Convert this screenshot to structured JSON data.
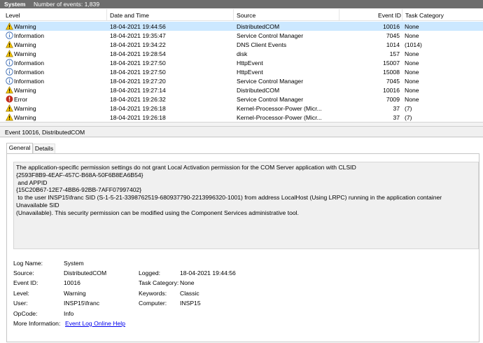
{
  "header": {
    "log_name": "System",
    "event_count": "Number of events: 1,839"
  },
  "columns": [
    "Level",
    "Date and Time",
    "Source",
    "Event ID",
    "Task Category"
  ],
  "rows": [
    {
      "level": "Warning",
      "icon": "warning-icon",
      "date": "18-04-2021 19:44:56",
      "source": "DistributedCOM",
      "event_id": "10016",
      "category": "None",
      "selected": true
    },
    {
      "level": "Information",
      "icon": "information-icon",
      "date": "18-04-2021 19:35:47",
      "source": "Service Control Manager",
      "event_id": "7045",
      "category": "None"
    },
    {
      "level": "Warning",
      "icon": "warning-icon",
      "date": "18-04-2021 19:34:22",
      "source": "DNS Client Events",
      "event_id": "1014",
      "category": "(1014)"
    },
    {
      "level": "Warning",
      "icon": "warning-icon",
      "date": "18-04-2021 19:28:54",
      "source": "disk",
      "event_id": "157",
      "category": "None"
    },
    {
      "level": "Information",
      "icon": "information-icon",
      "date": "18-04-2021 19:27:50",
      "source": "HttpEvent",
      "event_id": "15007",
      "category": "None"
    },
    {
      "level": "Information",
      "icon": "information-icon",
      "date": "18-04-2021 19:27:50",
      "source": "HttpEvent",
      "event_id": "15008",
      "category": "None"
    },
    {
      "level": "Information",
      "icon": "information-icon",
      "date": "18-04-2021 19:27:20",
      "source": "Service Control Manager",
      "event_id": "7045",
      "category": "None"
    },
    {
      "level": "Warning",
      "icon": "warning-icon",
      "date": "18-04-2021 19:27:14",
      "source": "DistributedCOM",
      "event_id": "10016",
      "category": "None"
    },
    {
      "level": "Error",
      "icon": "error-icon",
      "date": "18-04-2021 19:26:32",
      "source": "Service Control Manager",
      "event_id": "7009",
      "category": "None"
    },
    {
      "level": "Warning",
      "icon": "warning-icon",
      "date": "18-04-2021 19:26:18",
      "source": "Kernel-Processor-Power (Micr...",
      "event_id": "37",
      "category": "(7)"
    },
    {
      "level": "Warning",
      "icon": "warning-icon",
      "date": "18-04-2021 19:26:18",
      "source": "Kernel-Processor-Power (Micr...",
      "event_id": "37",
      "category": "(7)"
    }
  ],
  "event_title": "Event 10016, DistributedCOM",
  "tabs": {
    "general": "General",
    "details": "Details"
  },
  "message": "The application-specific permission settings do not grant Local Activation permission for the COM Server application with CLSID\n{2593F8B9-4EAF-457C-B68A-50F6B8EA6B54}\n and APPID\n{15C20B67-12E7-4BB6-92BB-7AFF07997402}\n to the user INSP15\\franc SID (S-1-5-21-3398762519-680937790-2213996320-1001) from address LocalHost (Using LRPC) running in the application container Unavailable SID\n(Unavailable). This security permission can be modified using the Component Services administrative tool.",
  "props": {
    "log_name": {
      "label": "Log Name:",
      "value": "System"
    },
    "source": {
      "label": "Source:",
      "value": "DistributedCOM"
    },
    "event_id": {
      "label": "Event ID:",
      "value": "10016"
    },
    "level": {
      "label": "Level:",
      "value": "Warning"
    },
    "user": {
      "label": "User:",
      "value": "INSP15\\franc"
    },
    "opcode": {
      "label": "OpCode:",
      "value": "Info"
    },
    "more_info": {
      "label": "More Information:",
      "value": "Event Log Online Help"
    },
    "logged": {
      "label": "Logged:",
      "value": "18-04-2021 19:44:56"
    },
    "task_category": {
      "label": "Task Category:",
      "value": "None"
    },
    "keywords": {
      "label": "Keywords:",
      "value": "Classic"
    },
    "computer": {
      "label": "Computer:",
      "value": "INSP15"
    }
  },
  "colors": {
    "selected_row": "#cce8ff",
    "warning": "#f5c400",
    "information": "#3f6fb5",
    "error": "#c42b1c",
    "link": "#0000ee"
  }
}
